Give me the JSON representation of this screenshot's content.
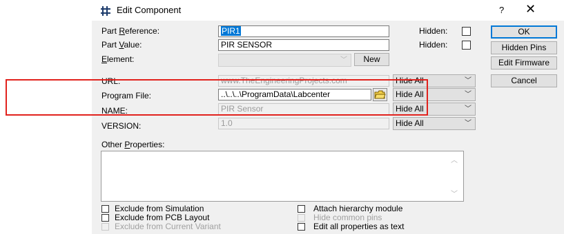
{
  "window": {
    "title": "Edit Component",
    "help_label": "?",
    "close_label": "✕"
  },
  "fields": {
    "part_reference": {
      "label": "Part Reference:",
      "value": "PIR1",
      "hidden_label": "Hidden:"
    },
    "part_value": {
      "label": "Part Value:",
      "value": "PIR SENSOR",
      "hidden_label": "Hidden:"
    },
    "element": {
      "label": "Element:",
      "value": "",
      "new_label": "New"
    },
    "url": {
      "label": "URL:",
      "value": "www.TheEngineeringProjects.com",
      "visibility": "Hide All"
    },
    "program_file": {
      "label": "Program File:",
      "value": "..\\..\\..\\ProgramData\\Labcenter",
      "visibility": "Hide All"
    },
    "name": {
      "label": "NAME:",
      "value": "PIR Sensor",
      "visibility": "Hide All"
    },
    "version": {
      "label": "VERSION:",
      "value": "1.0",
      "visibility": "Hide All"
    }
  },
  "other_properties": {
    "label": "Other Properties:",
    "value": ""
  },
  "options_left": [
    {
      "label": "Exclude from Simulation",
      "checked": false,
      "disabled": false
    },
    {
      "label": "Exclude from PCB Layout",
      "checked": false,
      "disabled": false
    },
    {
      "label": "Exclude from Current Variant",
      "checked": false,
      "disabled": true
    }
  ],
  "options_right": [
    {
      "label": "Attach hierarchy module",
      "checked": false,
      "disabled": false
    },
    {
      "label": "Hide common pins",
      "checked": false,
      "disabled": true
    },
    {
      "label": "Edit all properties as text",
      "checked": false,
      "disabled": false
    }
  ],
  "buttons": {
    "ok": "OK",
    "hidden_pins": "Hidden Pins",
    "edit_firmware": "Edit Firmware",
    "cancel": "Cancel"
  },
  "colors": {
    "highlight_box": "#e1211c",
    "selection": "#0078d7"
  }
}
